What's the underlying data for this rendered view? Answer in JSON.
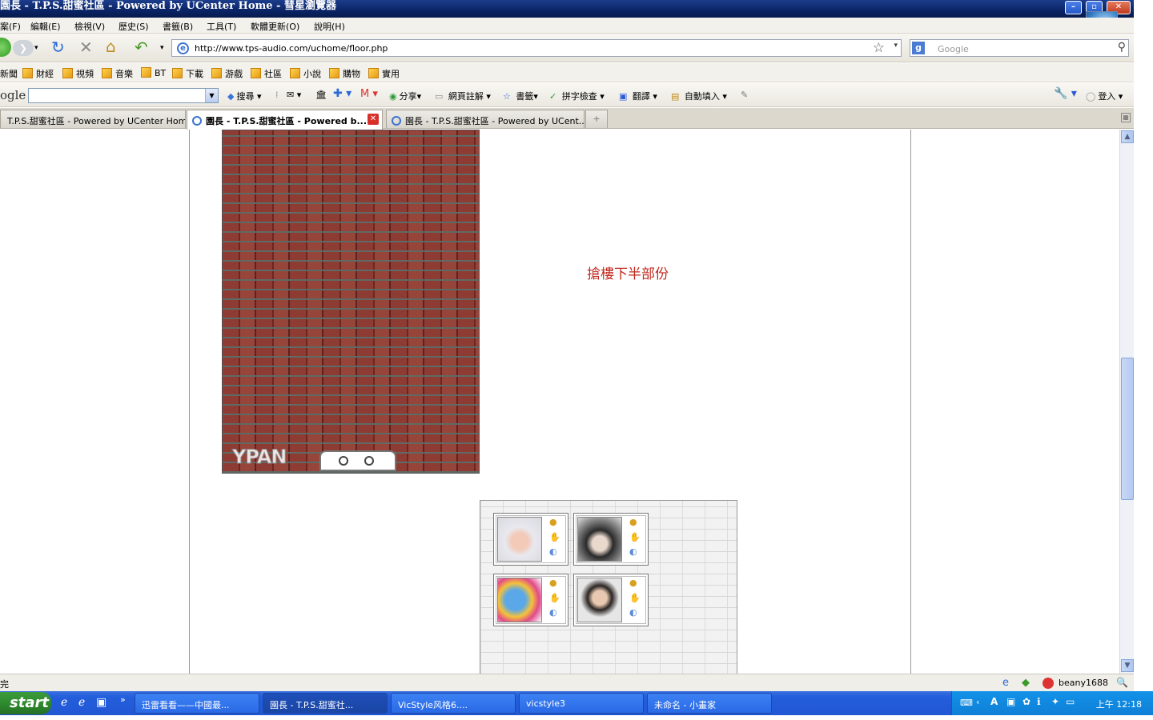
{
  "window": {
    "title": "園長 - T.P.S.甜蜜社區 - Powered by UCenter Home - 彗星瀏覽器",
    "minimize": "–",
    "maximize": "▫",
    "close": "✕"
  },
  "menu": [
    "案(F)",
    "編輯(E)",
    "檢視(V)",
    "歷史(S)",
    "書籤(B)",
    "工具(T)",
    "軟體更新(O)",
    "說明(H)"
  ],
  "nav": {
    "url": "http://www.tps-audio.com/uchome/floor.php",
    "search_placeholder": "Google"
  },
  "bookmarks": [
    "新聞",
    "財經",
    "視頻",
    "音樂",
    "BT",
    "下載",
    "游戲",
    "社區",
    "小說",
    "購物",
    "實用"
  ],
  "google_toolbar": {
    "logo": "ogle",
    "search_value": "",
    "items": [
      "搜尋",
      "分享",
      "網頁註解",
      "書籤",
      "拼字檢查",
      "翻譯",
      "自動填入"
    ],
    "login": "登入"
  },
  "tabs": [
    {
      "label": "T.P.S.甜蜜社區 - Powered by UCenter Home",
      "active": false
    },
    {
      "label": "園長 - T.P.S.甜蜜社區 - Powered b...",
      "active": true
    },
    {
      "label": "園長 - T.P.S.甜蜜社區 - Powered by UCent...",
      "active": false
    }
  ],
  "page": {
    "brick_logo": "YPAN",
    "red_text": "搶樓下半部份"
  },
  "status": {
    "text": "完",
    "user": "beany1688"
  },
  "taskbar": {
    "start": "start",
    "tasks": [
      {
        "label": "迅雷看看——中國最...",
        "active": false
      },
      {
        "label": "園長 - T.P.S.甜蜜社...",
        "active": true
      },
      {
        "label": "VicStyle风格6....",
        "active": false
      },
      {
        "label": "vicstyle3",
        "active": false
      },
      {
        "label": "未命名 - 小畫家",
        "active": false
      }
    ],
    "clock": "上午 12:18",
    "quick_more": "»"
  }
}
